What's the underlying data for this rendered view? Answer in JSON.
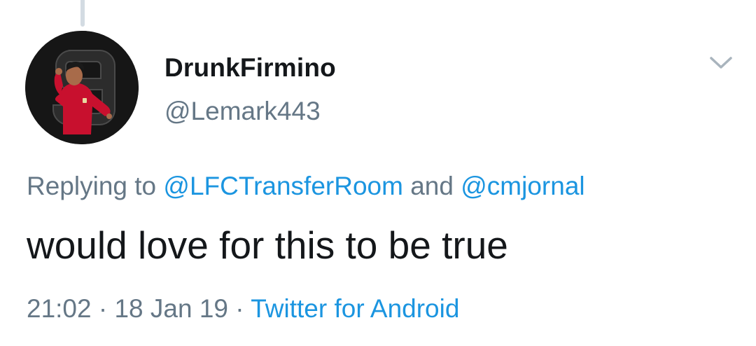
{
  "user": {
    "display_name": "DrunkFirmino",
    "handle": "@Lemark443",
    "avatar_icon": "footballer-avatar-icon"
  },
  "reply": {
    "prefix": "Replying to ",
    "mention_1": "@LFCTransferRoom",
    "conjunction": " and ",
    "mention_2": "@cmjornal"
  },
  "tweet": {
    "text": "would love for this to be true"
  },
  "meta": {
    "time": "21:02",
    "sep1": " · ",
    "date": "18 Jan 19",
    "sep2": " · ",
    "source": "Twitter for Android"
  },
  "menu": {
    "icon": "chevron-down-icon"
  },
  "colors": {
    "link": "#1b95e0",
    "secondary_text": "#657786",
    "primary_text": "#14171a",
    "avatar_bg": "#161616",
    "jersey_red": "#c8102e"
  }
}
